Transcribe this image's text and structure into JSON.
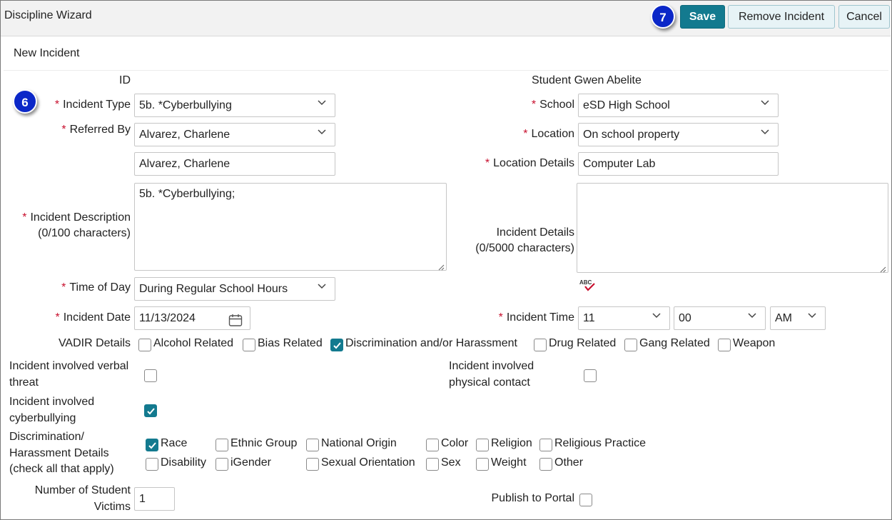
{
  "header": {
    "title": "Discipline Wizard",
    "step_badge_save": "7",
    "save_label": "Save",
    "remove_label": "Remove Incident",
    "cancel_label": "Cancel"
  },
  "section": {
    "title": "New Incident",
    "step_badge_type": "6"
  },
  "form": {
    "id_label": "ID",
    "student_label": "Student Gwen Abelite",
    "required_mark": "*",
    "incident_type": {
      "label": "Incident Type",
      "value": "5b. *Cyberbullying"
    },
    "referred_by": {
      "label": "Referred By",
      "value": "Alvarez, Charlene",
      "text_value": "Alvarez, Charlene"
    },
    "incident_description": {
      "label": "Incident Description",
      "sub_label": "(0/100 characters)",
      "value": "5b. *Cyberbullying;"
    },
    "time_of_day": {
      "label": "Time of Day",
      "value": "During Regular School Hours"
    },
    "incident_date": {
      "label": "Incident Date",
      "value": "11/13/2024"
    },
    "school": {
      "label": "School",
      "value": "eSD High School"
    },
    "location": {
      "label": "Location",
      "value": "On school property"
    },
    "location_details": {
      "label": "Location Details",
      "value": "Computer Lab"
    },
    "incident_details": {
      "label": "Incident Details",
      "sub_label": "(0/5000 characters)",
      "value": ""
    },
    "spellcheck_icon": "abc-spellcheck-icon",
    "incident_time": {
      "label": "Incident Time",
      "hour": "11",
      "minute": "00",
      "ampm": "AM"
    },
    "vadir": {
      "label": "VADIR Details",
      "options": [
        {
          "label": "Alcohol Related",
          "checked": false
        },
        {
          "label": "Bias Related",
          "checked": false
        },
        {
          "label": "Discrimination and/or Harassment",
          "checked": true
        },
        {
          "label": "Drug Related",
          "checked": false
        },
        {
          "label": "Gang Related",
          "checked": false
        },
        {
          "label": "Weapon",
          "checked": false
        }
      ]
    },
    "verbal_threat": {
      "label_line1": "Incident involved verbal",
      "label_line2": "threat",
      "checked": false
    },
    "physical_contact": {
      "label_line1": "Incident involved",
      "label_line2": "physical contact",
      "checked": false
    },
    "cyberbullying": {
      "label_line1": "Incident involved",
      "label_line2": "cyberbullying",
      "checked": true
    },
    "discrimination": {
      "label_line1": "Discrimination/",
      "label_line2": "Harassment Details",
      "label_line3": "(check all that apply)",
      "options": [
        {
          "label": "Race",
          "checked": true
        },
        {
          "label": "Ethnic Group",
          "checked": false
        },
        {
          "label": "National Origin",
          "checked": false
        },
        {
          "label": "Color",
          "checked": false
        },
        {
          "label": "Religion",
          "checked": false
        },
        {
          "label": "Religious Practice",
          "checked": false
        },
        {
          "label": "Disability",
          "checked": false
        },
        {
          "label": "iGender",
          "checked": false
        },
        {
          "label": "Sexual Orientation",
          "checked": false
        },
        {
          "label": "Sex",
          "checked": false
        },
        {
          "label": "Weight",
          "checked": false
        },
        {
          "label": "Other",
          "checked": false
        }
      ]
    },
    "victims": {
      "label_line1": "Number of Student",
      "label_line2": "Victims",
      "value": "1"
    },
    "publish_portal": {
      "label": "Publish to Portal",
      "checked": false
    }
  },
  "colors": {
    "accent": "#137a8f",
    "required": "#c8102e",
    "badge": "#0b27c8"
  }
}
